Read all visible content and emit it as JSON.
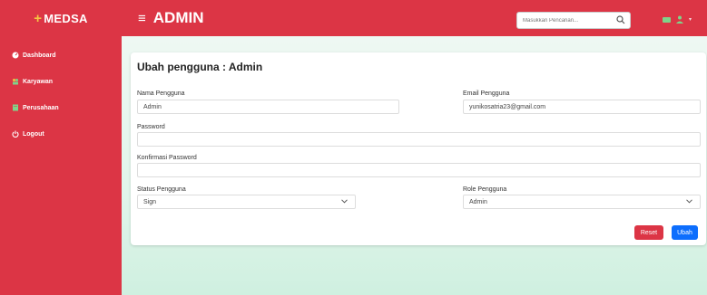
{
  "brand": {
    "plus": "+",
    "name": "MEDSA"
  },
  "header": {
    "title": "ADMIN",
    "menu_icon": "≡"
  },
  "search": {
    "placeholder": "Masukkan Pencarian..."
  },
  "icons": {
    "search": "search-icon",
    "mail": "envelope-icon",
    "user": "user-icon",
    "caret": "caret-down-icon"
  },
  "sidebar": {
    "items": [
      {
        "label": "Dashboard",
        "icon": "dashboard-icon"
      },
      {
        "label": "Karyawan",
        "icon": "users-icon"
      },
      {
        "label": "Perusahaan",
        "icon": "building-icon"
      },
      {
        "label": "Logout",
        "icon": "power-icon"
      }
    ]
  },
  "form": {
    "title": "Ubah pengguna : Admin",
    "nama_label": "Nama Pengguna",
    "nama_value": "Admin",
    "email_label": "Email Pengguna",
    "email_value": "yunikosatria23@gmail.com",
    "password_label": "Password",
    "password_value": "",
    "konfirmasi_label": "Konfirmasi Password",
    "konfirmasi_value": "",
    "status_label": "Status Pengguna",
    "status_value": "Sign",
    "role_label": "Role Pengguna",
    "role_value": "Admin",
    "reset_label": "Reset",
    "submit_label": "Ubah"
  },
  "colors": {
    "primary_red": "#dc3545",
    "primary_blue": "#0d6efd",
    "background_green": "#e1f5ea"
  }
}
